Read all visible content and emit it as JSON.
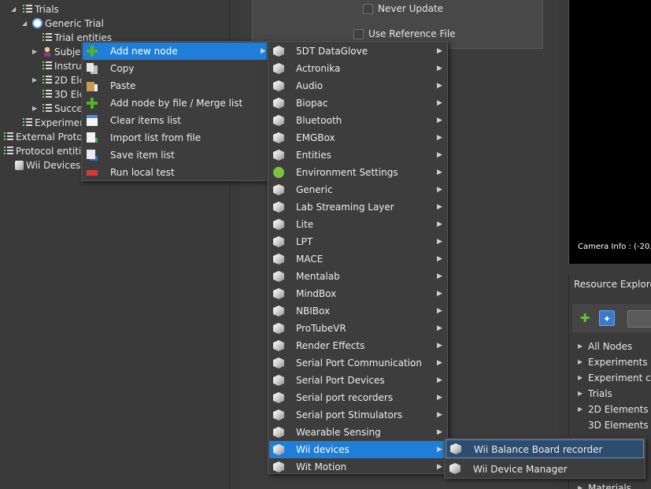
{
  "tree": {
    "items": [
      {
        "label": "Trials",
        "icon": "list-icon"
      },
      {
        "label": "Generic Trial",
        "icon": "clock-icon"
      },
      {
        "label": "Trial entities",
        "icon": "list-icon"
      },
      {
        "label": "Subjec",
        "icon": "person-icon"
      },
      {
        "label": "Instruc",
        "icon": "list-icon"
      },
      {
        "label": "2D Ele",
        "icon": "list-icon"
      },
      {
        "label": "3D Ele",
        "icon": "list-icon"
      },
      {
        "label": "Succes",
        "icon": "list-icon"
      },
      {
        "label": "Experiment",
        "icon": "list-icon"
      },
      {
        "label": "External Protoco",
        "icon": "list-icon"
      },
      {
        "label": "Protocol entitie",
        "icon": "list-icon"
      },
      {
        "label": "Wii Devices N",
        "icon": "cube-icon"
      }
    ]
  },
  "options": {
    "never_update": "Never Update",
    "use_reference_file": "Use Reference File"
  },
  "viewport": {
    "camera_info": "Camera Info : (-20.0"
  },
  "resource_explorer": {
    "title": "Resource Explorer",
    "items": [
      "All Nodes",
      "Experiments",
      "Experiment cor",
      "Trials",
      "2D Elements",
      "3D Elements",
      "Materials"
    ]
  },
  "context_menu": {
    "items": [
      {
        "label": "Add new node",
        "icon": "add-icon",
        "submenu": true
      },
      {
        "label": "Copy",
        "icon": "copy-icon",
        "submenu": false
      },
      {
        "label": "Paste",
        "icon": "paste-icon",
        "submenu": false
      },
      {
        "label": "Add node by file / Merge list",
        "icon": "add-icon",
        "submenu": false
      },
      {
        "label": "Clear items list",
        "icon": "window-icon",
        "submenu": false
      },
      {
        "label": "Import list from file",
        "icon": "import-icon",
        "submenu": false
      },
      {
        "label": "Save item list",
        "icon": "save-icon",
        "submenu": false
      },
      {
        "label": "Run local test",
        "icon": "test-icon",
        "submenu": false
      }
    ]
  },
  "node_menu": {
    "items": [
      "5DT DataGlove",
      "Actronika",
      "Audio",
      "Biopac",
      "Bluetooth",
      "EMGBox",
      "Entities",
      "Environment Settings",
      "Generic",
      "Lab Streaming Layer",
      "Lite",
      "LPT",
      "MACE",
      "Mentalab",
      "MindBox",
      "NBIBox",
      "ProTubeVR",
      "Render Effects",
      "Serial Port Communication",
      "Serial Port Devices",
      "Serial port recorders",
      "Serial port Stimulators",
      "Wearable Sensing",
      "Wii devices",
      "Wit Motion"
    ]
  },
  "wii_menu": {
    "items": [
      "Wii Balance Board recorder",
      "Wii Device Manager"
    ]
  },
  "colors": {
    "highlight": "#1f7fd8",
    "submenu_highlight_border": "#4a9ee0"
  },
  "glyphs": {
    "submenu_arrow": "▶",
    "tree_expand": "▶",
    "tree_collapse": "◢",
    "add": "✚",
    "pin": "✦"
  }
}
